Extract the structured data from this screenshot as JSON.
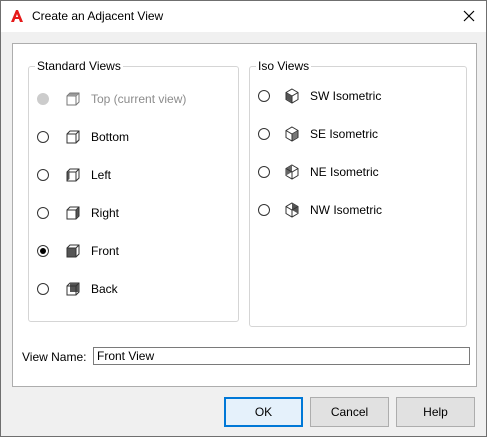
{
  "window": {
    "title": "Create an Adjacent View",
    "app_icon": "autocad-logo-icon",
    "close_icon": "close-icon",
    "accent_color": "#0078d7",
    "brand_color": "#e51a1a"
  },
  "standard_views": {
    "legend": "Standard Views",
    "items": [
      {
        "label": "Top (current view)",
        "selected": false,
        "disabled": true,
        "icon": "cube-top-icon"
      },
      {
        "label": "Bottom",
        "selected": false,
        "disabled": false,
        "icon": "cube-bottom-icon"
      },
      {
        "label": "Left",
        "selected": false,
        "disabled": false,
        "icon": "cube-left-icon"
      },
      {
        "label": "Right",
        "selected": false,
        "disabled": false,
        "icon": "cube-right-icon"
      },
      {
        "label": "Front",
        "selected": true,
        "disabled": false,
        "icon": "cube-front-icon"
      },
      {
        "label": "Back",
        "selected": false,
        "disabled": false,
        "icon": "cube-back-icon"
      }
    ]
  },
  "iso_views": {
    "legend": "Iso Views",
    "items": [
      {
        "label": "SW Isometric",
        "selected": false,
        "icon": "iso-sw-icon"
      },
      {
        "label": "SE Isometric",
        "selected": false,
        "icon": "iso-se-icon"
      },
      {
        "label": "NE Isometric",
        "selected": false,
        "icon": "iso-ne-icon"
      },
      {
        "label": "NW Isometric",
        "selected": false,
        "icon": "iso-nw-icon"
      }
    ]
  },
  "view_name": {
    "label": "View Name:",
    "value": "Front View"
  },
  "buttons": {
    "ok": "OK",
    "cancel": "Cancel",
    "help": "Help"
  }
}
